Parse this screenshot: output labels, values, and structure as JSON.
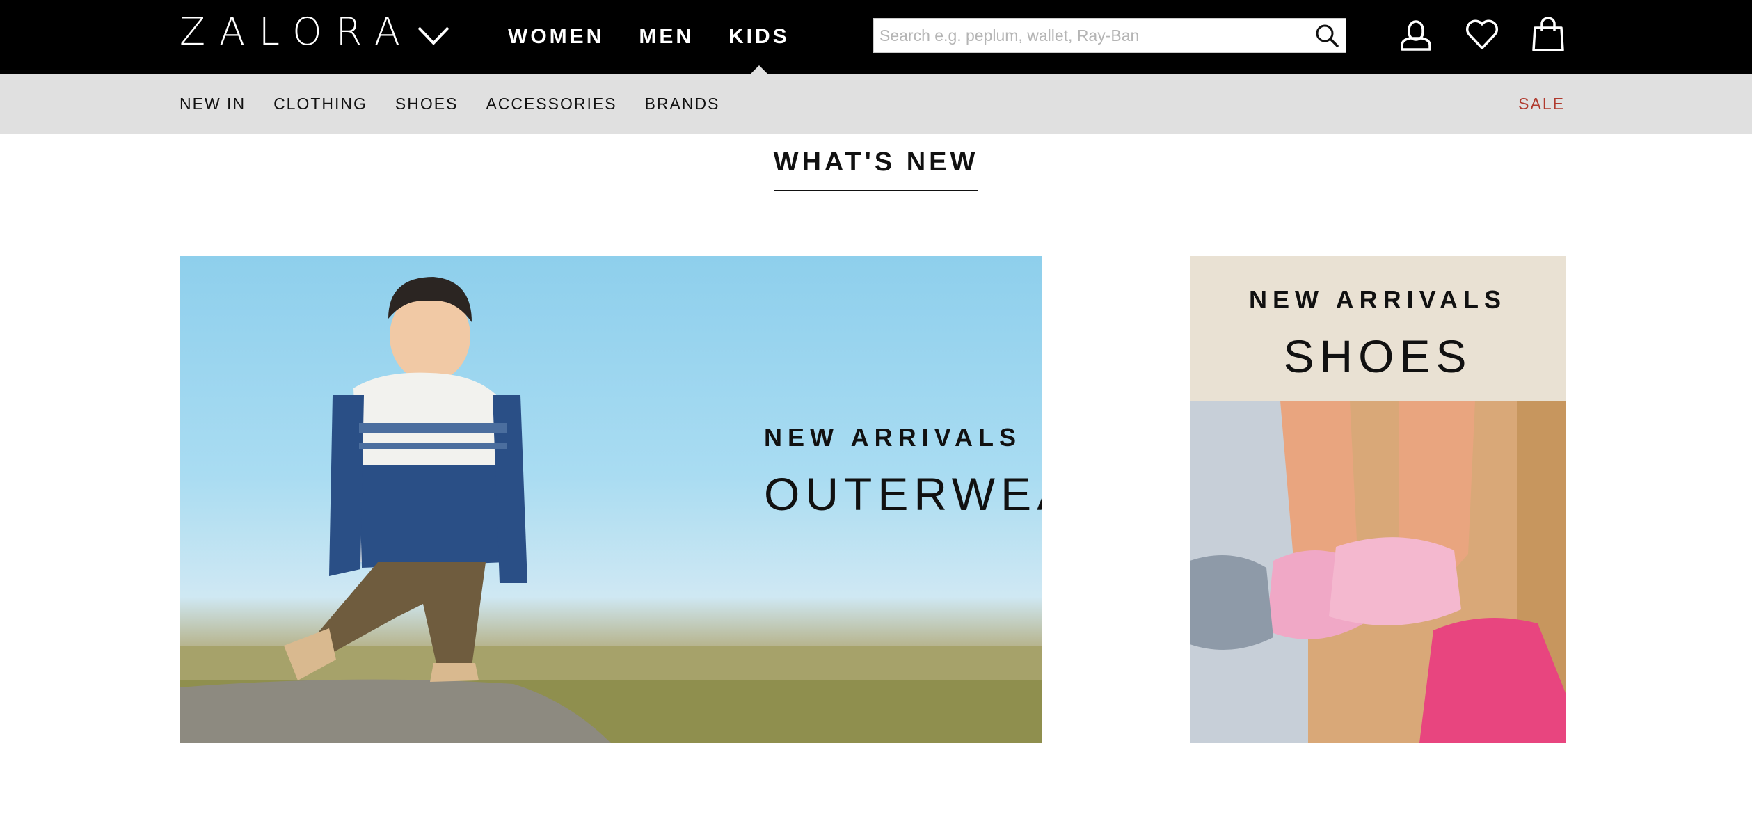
{
  "header": {
    "logo": "ZALORA",
    "gender_tabs": [
      {
        "label": "WOMEN",
        "active": false
      },
      {
        "label": "MEN",
        "active": false
      },
      {
        "label": "KIDS",
        "active": true
      }
    ],
    "search": {
      "placeholder": "Search e.g. peplum, wallet, Ray-Ban",
      "value": ""
    },
    "icons": [
      "account-icon",
      "heart-icon",
      "shopping-bag-icon"
    ]
  },
  "category_nav": {
    "items": [
      "NEW IN",
      "CLOTHING",
      "SHOES",
      "ACCESSORIES",
      "BRANDS"
    ],
    "sale": "SALE",
    "sale_color": "#b03a2e"
  },
  "section": {
    "title": "WHAT'S NEW"
  },
  "banners": [
    {
      "kicker": "NEW ARRIVALS",
      "headline": "OUTERWEAR"
    },
    {
      "kicker": "NEW ARRIVALS",
      "headline": "SHOES"
    }
  ],
  "colors": {
    "header_bg": "#000000",
    "category_bar_bg": "#e0e0e0",
    "shoes_banner_bg": "#e9e1d3"
  }
}
